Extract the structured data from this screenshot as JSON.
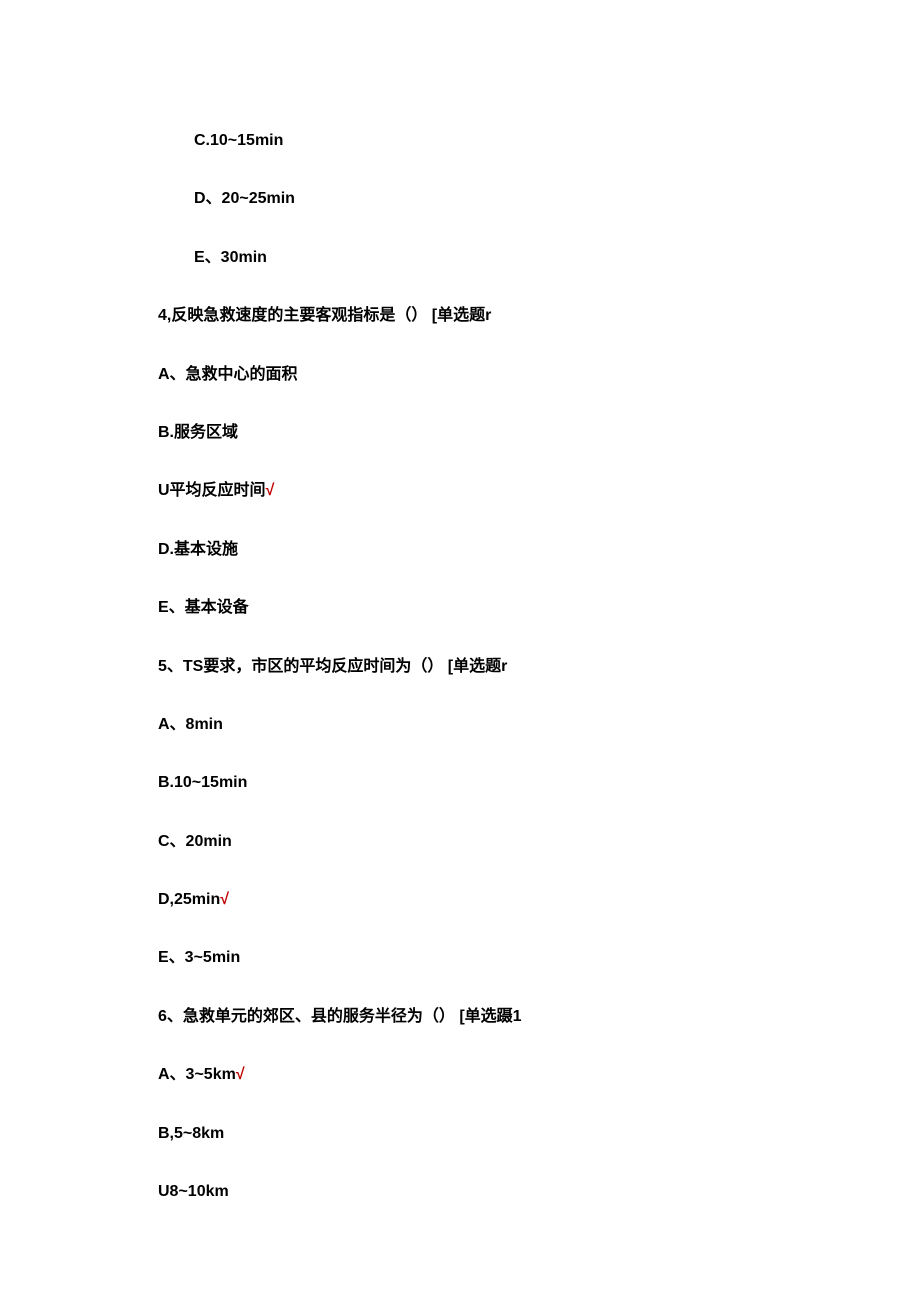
{
  "remainder_options": {
    "c": "C.10~15min",
    "d": "D、20~25min",
    "e": "E、30min"
  },
  "q4": {
    "stem": "4,反映急救速度的主要客观指标是（）  [单选题r",
    "a": "A、急救中心的面积",
    "b": "B.服务区域",
    "c_prefix": "U平均反应时间",
    "c_mark": "√",
    "d": "D.基本设施",
    "e": "E、基本设备"
  },
  "q5": {
    "stem": "5、TS要求，市区的平均反应时间为（）  [单选题r",
    "a": "A、8min",
    "b": "B.10~15min",
    "c": "C、20min",
    "d_prefix": "D,25min",
    "d_mark": "√",
    "e": "E、3~5min"
  },
  "q6": {
    "stem": "6、急救单元的郊区、县的服务半径为（）  [单选蹑1",
    "a_prefix": "A、3~5km",
    "a_mark": "√",
    "b": "B,5~8km",
    "c": "U8~10km"
  }
}
